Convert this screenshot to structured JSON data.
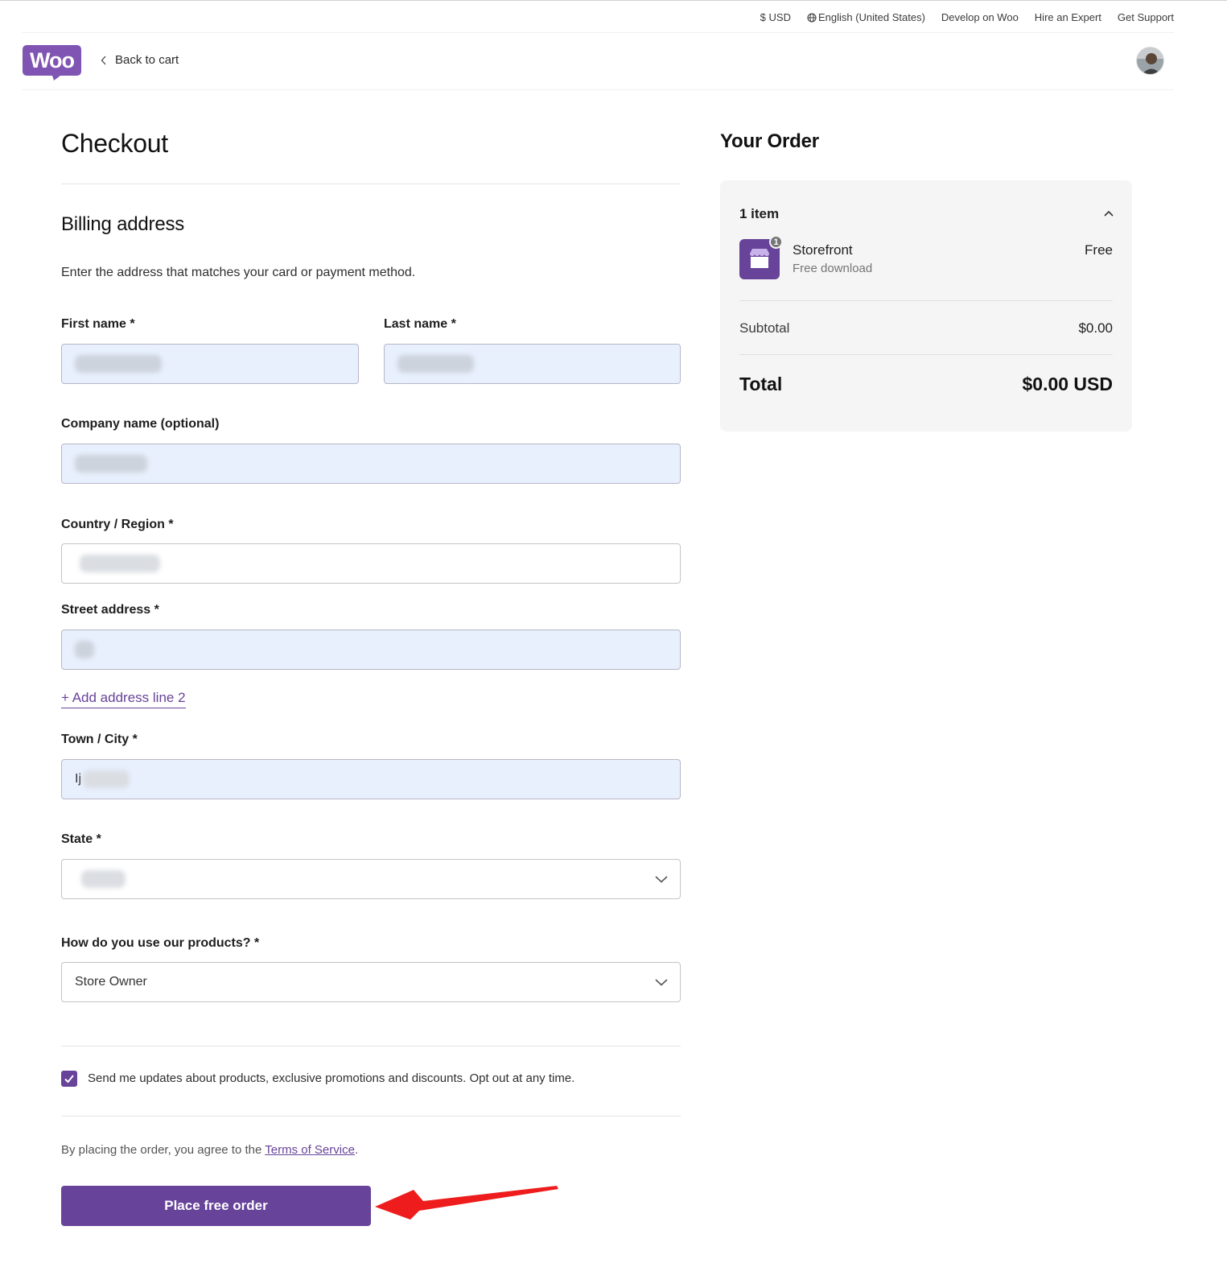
{
  "utility_bar": {
    "currency": "$ USD",
    "language": "English (United States)",
    "develop": "Develop on Woo",
    "hire": "Hire an Expert",
    "support": "Get Support"
  },
  "header": {
    "logo_text": "Woo",
    "back_label": "Back to cart"
  },
  "checkout": {
    "title": "Checkout",
    "section_title": "Billing address",
    "section_desc": "Enter the address that matches your card or payment method.",
    "fields": {
      "first_name_label": "First name *",
      "last_name_label": "Last name *",
      "company_label": "Company name (optional)",
      "country_label": "Country / Region *",
      "street_label": "Street address *",
      "add_line_label": "+ Add address line 2",
      "city_label": "Town / City *",
      "city_value_prefix": "Ij",
      "state_label": "State *",
      "usage_label": "How do you use our products? *",
      "usage_value": "Store Owner"
    },
    "updates_checkbox": {
      "checked": true,
      "label": "Send me updates about products, exclusive promotions and discounts. Opt out at any time."
    },
    "terms_prefix": "By placing the order, you agree to the ",
    "terms_link": "Terms of Service",
    "terms_suffix": ".",
    "place_order_label": "Place free order"
  },
  "order": {
    "title": "Your Order",
    "items_count": "1 item",
    "product": {
      "name": "Storefront",
      "subtitle": "Free download",
      "price": "Free",
      "qty": "1"
    },
    "subtotal_label": "Subtotal",
    "subtotal_value": "$0.00",
    "total_label": "Total",
    "total_value": "$0.00 USD"
  },
  "colors": {
    "brand": "#674399",
    "autofill_bg": "#e8f0fe",
    "card_bg": "#f4f5f4",
    "annotation_arrow": "#ee1c1c"
  },
  "icons": {
    "language": "globe-icon",
    "back": "chevron-left-icon",
    "collapse": "chevron-up-icon",
    "select": "chevron-down-icon",
    "checkbox": "check-icon",
    "annotation": "red-arrow-icon"
  }
}
